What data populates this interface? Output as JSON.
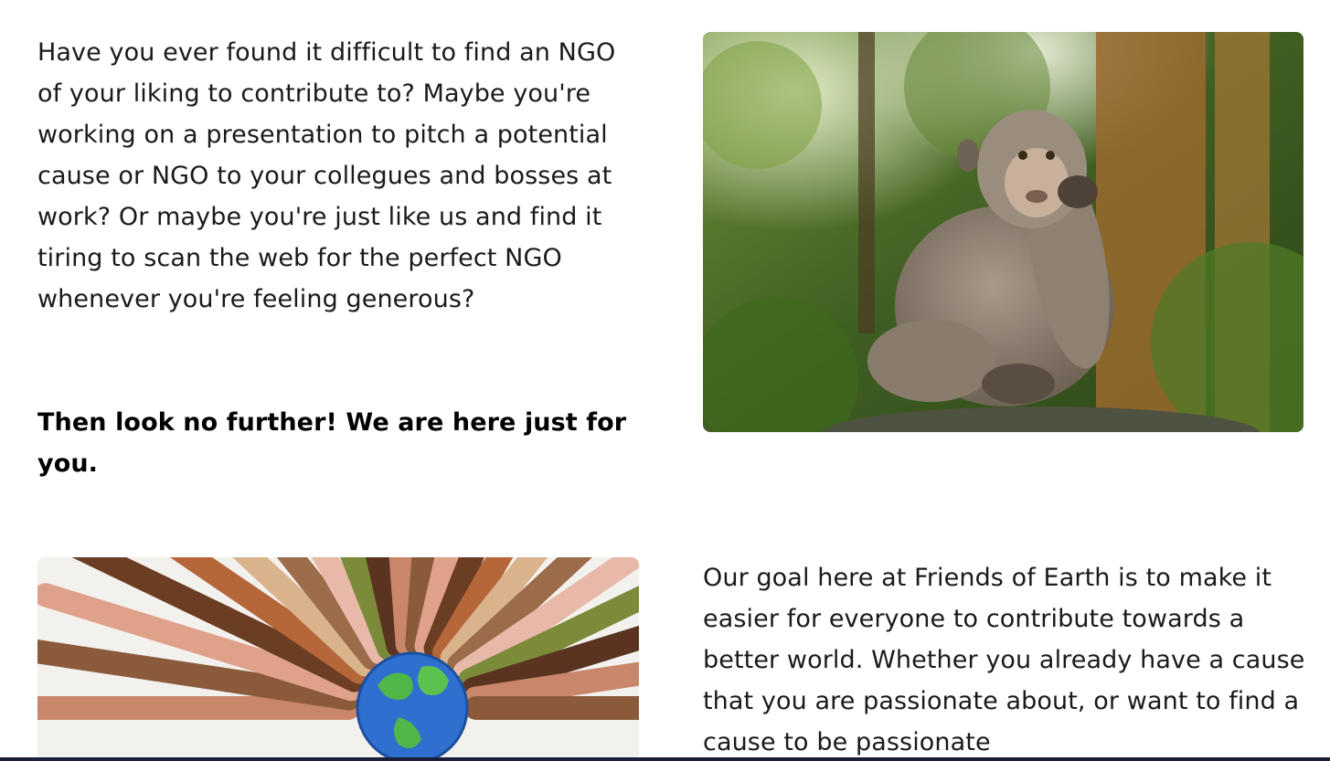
{
  "intro": {
    "paragraph": "Have you ever found it difficult to find an NGO of your liking to contribute to? Maybe you're working on a presentation to pitch a potential cause or NGO to your collegues and bosses at work? Or maybe you're just like us and find it tiring to scan the web for the perfect NGO whenever you're feeling generous?",
    "callout": "Then look no further! We are here just for you."
  },
  "goal": {
    "paragraph": "Our goal here at Friends of Earth is to make it easier for everyone to contribute towards a better world. Whether you already have a cause that you are passionate about, or want to find a cause to be passionate"
  },
  "images": {
    "monkey": "thinking-monkey-photo",
    "hands": "hands-around-globe-illustration"
  },
  "colors": {
    "text": "#1a1a1a",
    "bottom_bar": "#1b1f3b"
  }
}
